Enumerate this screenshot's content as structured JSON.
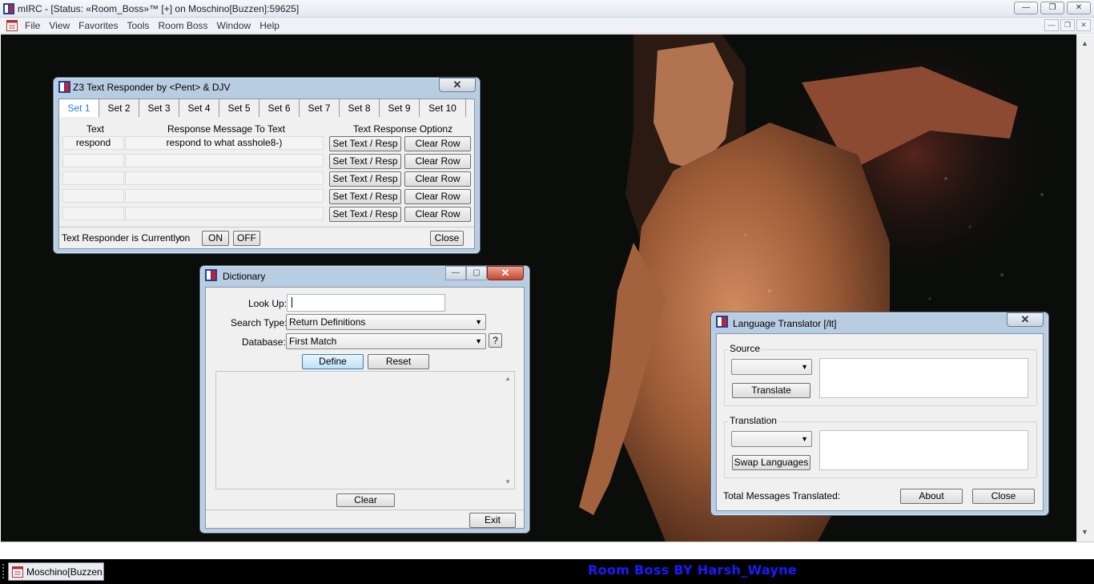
{
  "window": {
    "title": "mIRC - [Status: «Room_Boss»™ [+] on Moschino[Buzzen]:59625]",
    "controls": [
      "—",
      "❐",
      "✕"
    ]
  },
  "menubar": {
    "items": [
      "File",
      "View",
      "Favorites",
      "Tools",
      "Room Boss",
      "Window",
      "Help"
    ]
  },
  "z3": {
    "title": "Z3 Text Responder by <Pent> & DJV",
    "close": "✕",
    "tabs": [
      "Set 1",
      "Set 2",
      "Set 3",
      "Set 4",
      "Set 5",
      "Set 6",
      "Set 7",
      "Set 8",
      "Set 9",
      "Set 10"
    ],
    "active_tab": "Set 1",
    "headers": {
      "text": "Text",
      "response": "Response Message To Text",
      "options": "Text Response Optionz"
    },
    "rows": [
      {
        "text": "respond",
        "response": "respond to what asshole8-)"
      },
      {
        "text": "",
        "response": ""
      },
      {
        "text": "",
        "response": ""
      },
      {
        "text": "",
        "response": ""
      },
      {
        "text": "",
        "response": ""
      }
    ],
    "set_btn": "Set Text / Resp",
    "clear_btn": "Clear Row",
    "status_label": "Text Responder is Currently:",
    "status_value": "on",
    "on_btn": "ON",
    "off_btn": "OFF",
    "close_btn": "Close"
  },
  "dictionary": {
    "title": "Dictionary",
    "lookup_label": "Look Up:",
    "lookup_value": "",
    "search_type_label": "Search Type:",
    "search_type_value": "Return Definitions",
    "database_label": "Database:",
    "database_value": "First Match",
    "help_btn": "?",
    "define_btn": "Define",
    "reset_btn": "Reset",
    "clear_btn": "Clear",
    "exit_btn": "Exit"
  },
  "translator": {
    "title": "Language Translator [/lt]",
    "source_label": "Source",
    "translate_btn": "Translate",
    "translation_label": "Translation",
    "swap_btn": "Swap Languages",
    "total_label": "Total Messages Translated:",
    "about_btn": "About",
    "close_btn": "Close"
  },
  "taskbar": {
    "item": "Moschino[Buzzen...",
    "branding": "Room Boss BY Harsh_Wayne"
  },
  "colors": {
    "branding": "#1a1aff",
    "active_tab": "#2c7be5",
    "close_red": "#c7452b"
  }
}
